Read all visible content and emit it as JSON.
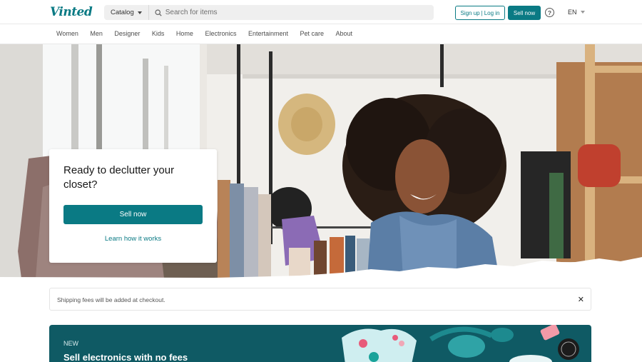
{
  "header": {
    "logo": "Vinted",
    "catalog_label": "Catalog",
    "search_placeholder": "Search for items",
    "signup_label": "Sign up",
    "login_label": "Log in",
    "sell_now_label": "Sell now",
    "help_glyph": "?",
    "language": "EN"
  },
  "categories": [
    "Women",
    "Men",
    "Designer",
    "Kids",
    "Home",
    "Electronics",
    "Entertainment",
    "Pet care",
    "About"
  ],
  "hero": {
    "title": "Ready to declutter your closet?",
    "sell_button": "Sell now",
    "learn_link": "Learn how it works"
  },
  "notice": {
    "text": "Shipping fees will be added at checkout.",
    "close_glyph": "✕"
  },
  "banner": {
    "tag": "NEW",
    "title": "Sell electronics with no fees"
  },
  "colors": {
    "brand": "#0a7a84",
    "banner_bg": "#0f5a64"
  }
}
